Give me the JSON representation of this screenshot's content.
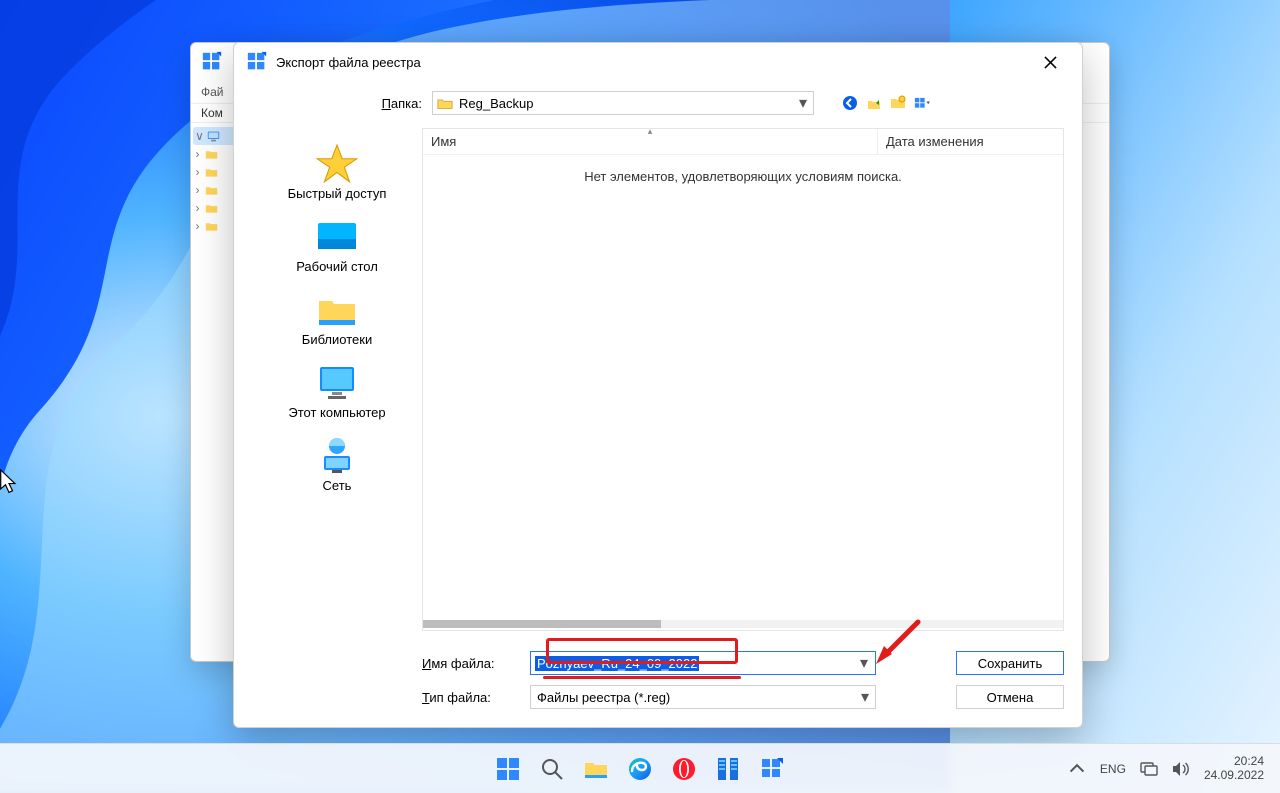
{
  "regedit": {
    "menu_file": "Фай",
    "header_computer": "Ком",
    "tree_expander": "∨"
  },
  "dialog": {
    "title": "Экспорт файла реестра",
    "folder_label_u": "П",
    "folder_label_rest": "апка:",
    "folder_value": "Reg_Backup",
    "list": {
      "col_name": "Имя",
      "col_date": "Дата изменения",
      "empty": "Нет элементов, удовлетворяющих условиям поиска."
    },
    "nav": {
      "quick": "Быстрый доступ",
      "desktop": "Рабочий стол",
      "libraries": "Библиотеки",
      "thispc": "Этот компьютер",
      "network": "Сеть"
    },
    "filename_label_u": "И",
    "filename_label_rest": "мя файла:",
    "filename_value": "Poznyaev_Ru_24_09_2022",
    "filetype_label_u": "Т",
    "filetype_label_rest": "ип файла:",
    "filetype_value": "Файлы реестра (*.reg)",
    "save": "Сохранить",
    "cancel": "Отмена"
  },
  "taskbar": {
    "lang": "ENG",
    "time": "20:24",
    "date": "24.09.2022"
  }
}
